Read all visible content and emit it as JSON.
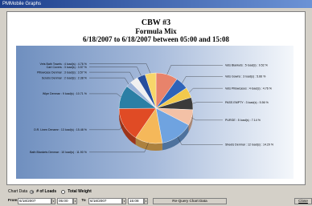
{
  "window": {
    "title": "PMMobile Graphs"
  },
  "chart": {
    "title": "CBW #3",
    "subtitle": "Formula Mix",
    "range": "6/18/2007 to 6/18/2007 between 05:00 and 15:08"
  },
  "chart_data": {
    "type": "pie",
    "title": "CBW #3",
    "slices": [
      {
        "label": "Vets Blankets : 5 load(s) : 9.52 %",
        "value": 9.52,
        "color": "#e8836b"
      },
      {
        "label": "Vets Gowns : 3 load(s) : 5.66 %",
        "value": 5.66,
        "color": "#2e63b8"
      },
      {
        "label": "Vets Pillowcases : 4 load(s) : 4.76 %",
        "value": 4.76,
        "color": "#f2c94c"
      },
      {
        "label": "PASS EMPTY : 3 load(s) : 5.56 %",
        "value": 5.56,
        "color": "#3b3b3b"
      },
      {
        "label": "PURGE : 5 load(s) : 7.14 %",
        "value": 7.14,
        "color": "#f3c1a6"
      },
      {
        "label": "Sheets Denmar : 12 load(s) : 14.29 %",
        "value": 14.29,
        "color": "#6fa3e0"
      },
      {
        "label": "Bath Blankets Denmar : 10 load(s) : 11.90 %",
        "value": 11.9,
        "color": "#f5b85a"
      },
      {
        "label": "O.R. Linen Denamr : 13 load(s) : 15.48 %",
        "value": 15.48,
        "color": "#e04b25"
      },
      {
        "label": "Wipe Denmar : 9 load(s) : 10.71 %",
        "value": 10.71,
        "color": "#2b7fa5"
      },
      {
        "label": "Scrubs Denmar : 2 load(s) : 2.38 %",
        "value": 2.38,
        "color": "#9ab2d8"
      },
      {
        "label": "Pillowcase Denmar : 3 load(s) : 3.57 %",
        "value": 3.57,
        "color": "#f0f0f0"
      },
      {
        "label": "Cart Covers : 3 load(s) : 3.57 %",
        "value": 3.57,
        "color": "#264e9e"
      },
      {
        "label": "Vets Bath Towels : 4 load(s) : 4.76 %",
        "value": 4.76,
        "color": "#f7d66a"
      }
    ]
  },
  "controls": {
    "chart_data_label": "Chart Data",
    "option_loads": "# of Loads",
    "option_weight": "Total Weight",
    "from_label": "From",
    "from_date": "6/18/2007",
    "from_time": "05:00",
    "to_label": "To",
    "to_date": "6/18/2007",
    "to_time": "15:08",
    "requery_label": "Re-Query Chart Data",
    "close_label": "Close"
  }
}
